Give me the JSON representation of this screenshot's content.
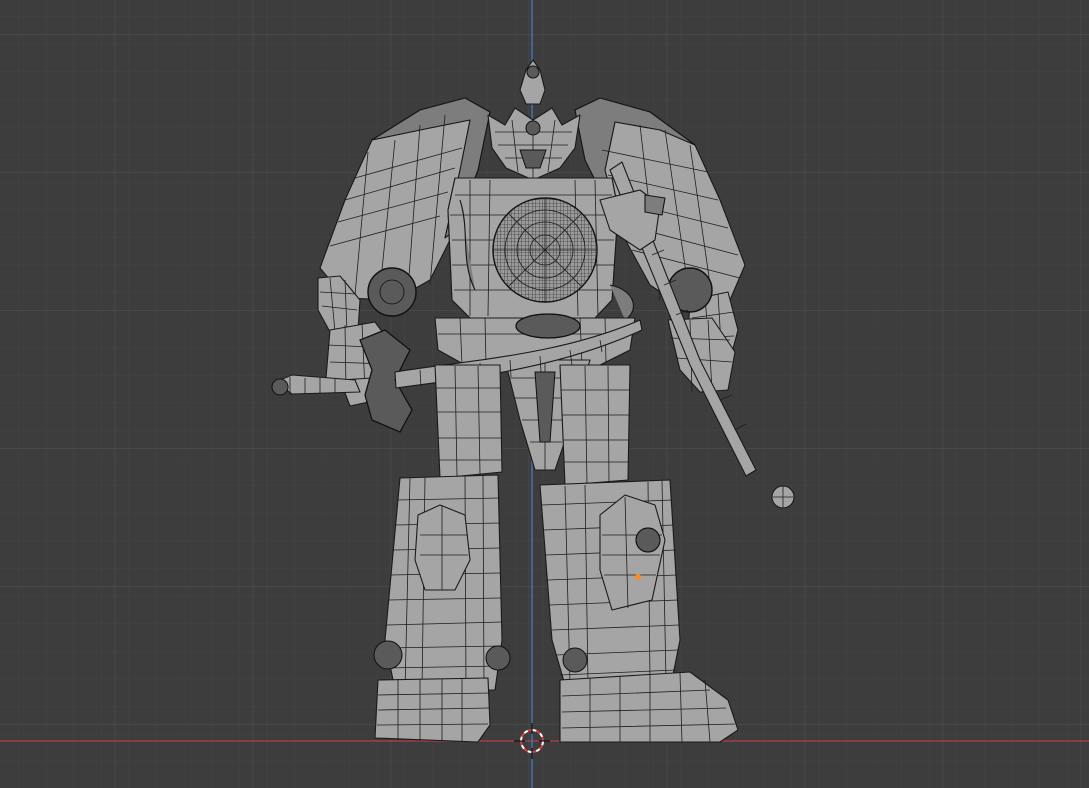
{
  "viewport": {
    "background_color": "#3d3d3d",
    "grid_minor_color": "#454545",
    "grid_major_color": "#4f4f4f",
    "x_axis_color": "#b0404a",
    "y_axis_color": "#4a78c4",
    "mesh_fill_color": "#a5a5a5",
    "wire_color": "#1a1a1a",
    "selected_vertex_color": "#ff8a1f",
    "cursor_colors": [
      "#e03c3c",
      "#ffffff"
    ]
  },
  "scene": {
    "object": "robot-mesh",
    "view": "front-orthographic",
    "shading": "solid-with-wireframe"
  },
  "icons": {
    "cursor": "3d-cursor-icon"
  }
}
